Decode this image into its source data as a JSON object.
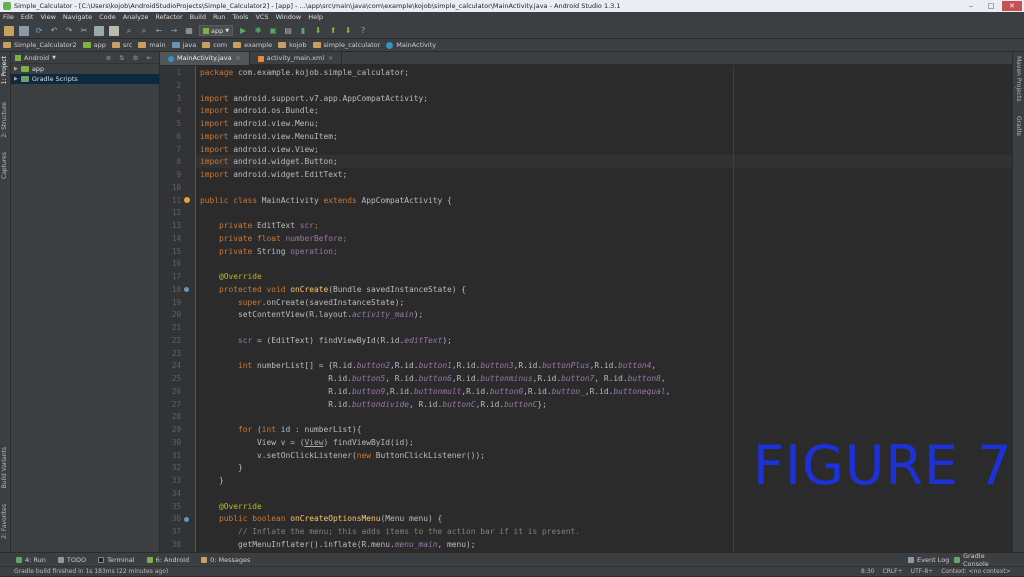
{
  "window": {
    "title": "Simple_Calculator - [C:\\Users\\kojob\\AndroidStudioProjects\\Simple_Calculator2] - [app] - ...\\app\\src\\main\\java\\com\\example\\kojob\\simple_calculator\\MainActivity.java - Android Studio 1.3.1",
    "minimize": "–",
    "maximize": "□",
    "close": "✕"
  },
  "menu": [
    "File",
    "Edit",
    "View",
    "Navigate",
    "Code",
    "Analyze",
    "Refactor",
    "Build",
    "Run",
    "Tools",
    "VCS",
    "Window",
    "Help"
  ],
  "toolbar": {
    "run_config": "app"
  },
  "breadcrumbs": [
    "Simple_Calculator2",
    "app",
    "src",
    "main",
    "java",
    "com",
    "example",
    "kojob",
    "simple_calculator",
    "MainActivity"
  ],
  "project_panel": {
    "view_mode": "Android",
    "items": [
      "app",
      "Gradle Scripts"
    ]
  },
  "left_tabs": [
    "1: Project",
    "2: Structure",
    "Captures",
    "Build Variants",
    "2: Favorites"
  ],
  "right_tabs": [
    "Maven Projects",
    "Gradle"
  ],
  "editor_tabs": [
    {
      "label": "MainActivity.java",
      "active": true
    },
    {
      "label": "activity_main.xml",
      "active": false
    }
  ],
  "line_numbers": [
    "1",
    "2",
    "3",
    "4",
    "5",
    "6",
    "7",
    "8",
    "9",
    "10",
    "11",
    "12",
    "13",
    "14",
    "15",
    "16",
    "17",
    "18",
    "19",
    "20",
    "21",
    "22",
    "23",
    "24",
    "25",
    "26",
    "27",
    "28",
    "29",
    "30",
    "31",
    "32",
    "33",
    "34",
    "35",
    "36",
    "37",
    "38"
  ],
  "code": {
    "l1_kw": "package ",
    "l1": "com.example.kojob.simple_calculator;",
    "l3_kw": "import ",
    "l3": "android.support.v7.app.AppCompatActivity;",
    "l4_kw": "import ",
    "l4": "android.os.Bundle;",
    "l5_kw": "import ",
    "l5": "android.view.Menu;",
    "l6_kw": "import ",
    "l6": "android.view.MenuItem;",
    "l7_kw": "import ",
    "l7": "android.view.View;",
    "l8_kw": "import ",
    "l8": "android.widget.Button;",
    "l9_kw": "import ",
    "l9": "android.widget.EditText;",
    "l11_kw": "public class ",
    "l11_a": "MainActivity ",
    "l11_kw2": "extends ",
    "l11_b": "AppCompatActivity {",
    "l13_kw": "    private ",
    "l13_a": "EditText ",
    "l13_f": "scr",
    "l13_b": ";",
    "l14_kw": "    private float ",
    "l14_f": "numberBefore",
    "l14_b": ";",
    "l15_kw": "    private ",
    "l15_a": "String ",
    "l15_f": "operation",
    "l15_b": ";",
    "l17": "    @Override",
    "l18_kw": "    protected void ",
    "l18_fn": "onCreate",
    "l18_b": "(Bundle savedInstanceState) {",
    "l19_kw": "        super",
    "l19_b": ".onCreate(savedInstanceState);",
    "l20_a": "        setContentView(R.layout.",
    "l20_it": "activity_main",
    "l20_b": ");",
    "l22_a": "        ",
    "l22_f": "scr",
    "l22_b": " = (EditText) findViewById(R.id.",
    "l22_it": "editText",
    "l22_c": ");",
    "l24_kw": "        int ",
    "l24_a": "numberList[] = {R.id.",
    "l24_i1": "button2",
    "l24_b": ",R.id.",
    "l24_i2": "button1",
    "l24_c": ",R.id.",
    "l24_i3": "button3",
    "l24_d": ",R.id.",
    "l24_i4": "buttonPlus",
    "l24_e": ",R.id.",
    "l24_i5": "button4",
    "l24_f": ",",
    "l25_a": "                           R.id.",
    "l25_i1": "button5",
    "l25_b": ", R.id.",
    "l25_i2": "button6",
    "l25_c": ",R.id.",
    "l25_i3": "buttonminus",
    "l25_d": ",R.id.",
    "l25_i4": "button7",
    "l25_e": ", R.id.",
    "l25_i5": "button8",
    "l25_f": ",",
    "l26_a": "                           R.id.",
    "l26_i1": "button9",
    "l26_b": ",R.id.",
    "l26_i2": "buttonmult",
    "l26_c": ",R.id.",
    "l26_i3": "button0",
    "l26_d": ",R.id.",
    "l26_i4": "button_",
    "l26_e": ",R.id.",
    "l26_i5": "buttonequal",
    "l26_f": ",",
    "l27_a": "                           R.id.",
    "l27_i1": "buttondivide",
    "l27_b": ", R.id.",
    "l27_i2": "buttonC",
    "l27_c": ",R.id.",
    "l27_i3": "buttonC",
    "l27_d": "};",
    "l29_kw": "        for ",
    "l29_a": "(",
    "l29_kw2": "int ",
    "l29_b": "id : numberList){",
    "l30_a": "            View v = (",
    "l30_u": "View",
    "l30_b": ") findViewById(id);",
    "l31_a": "            v.setOnClickListener(",
    "l31_kw": "new ",
    "l31_b": "ButtonClickListener());",
    "l32": "        }",
    "l33": "    }",
    "l35": "    @Override",
    "l36_kw": "    public boolean ",
    "l36_fn": "onCreateOptionsMenu",
    "l36_b": "(Menu menu) {",
    "l37": "        // Inflate the menu; this adds items to the action bar if it is present.",
    "l38_a": "        getMenuInflater().inflate(R.menu.",
    "l38_it": "menu_main",
    "l38_b": ", menu);"
  },
  "overlay_label": "FIGURE 7",
  "bottom_tabs": [
    "4: Run",
    "TODO",
    "Terminal",
    "6: Android",
    "0: Messages"
  ],
  "bottom_right_tabs": [
    "Event Log",
    "Gradle Console"
  ],
  "status": {
    "message": "Gradle build finished in 1s 183ms (22 minutes ago)",
    "position": "8:30",
    "line_sep": "CRLF÷",
    "encoding": "UTF-8÷",
    "context": "Context: <no context>"
  },
  "colors": {
    "keyword": "#cc7832",
    "field": "#9876aa",
    "method": "#ffc66d",
    "annotation": "#bbb529",
    "comment": "#808080",
    "figure_label": "#1d31d8"
  }
}
